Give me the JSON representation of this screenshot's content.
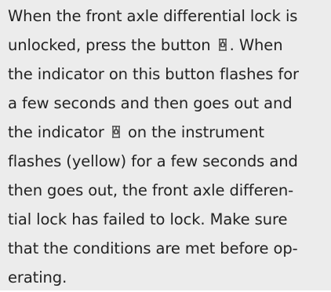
{
  "note": {
    "lines": [
      {
        "text": "When the front axle differential lock is"
      },
      {
        "before": "unlocked, press the button ",
        "icon": "differential-lock-icon",
        "after": ". When"
      },
      {
        "text": "the indicator on this button flashes for"
      },
      {
        "text": "a few seconds and then goes out and"
      },
      {
        "before": "the indicator ",
        "icon": "differential-lock-icon",
        "after": " on the instrument"
      },
      {
        "text": "flashes (yellow) for a few seconds and"
      },
      {
        "text": "then goes out, the front axle differen-"
      },
      {
        "text": "tial lock has failed to lock. Make sure"
      },
      {
        "text": "that the conditions are met before op-"
      },
      {
        "text": "erating."
      }
    ]
  }
}
